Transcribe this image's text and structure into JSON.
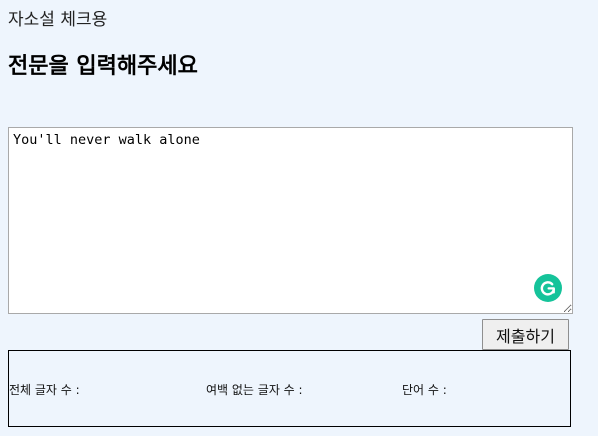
{
  "app": {
    "title": "자소설 체크용"
  },
  "main": {
    "heading": "전문을 입력해주세요",
    "textarea_value": "You'll never walk alone",
    "submit_label": "제출하기"
  },
  "extension": {
    "icon": "grammarly-icon",
    "color": "#15c39a"
  },
  "results": {
    "total_chars_label": "전체 글자 수 :",
    "no_space_chars_label": "여백 없는 글자 수 :",
    "word_count_label": "단어 수 :"
  },
  "colors": {
    "page_background": "#eef5fd",
    "button_background": "#efefef"
  }
}
